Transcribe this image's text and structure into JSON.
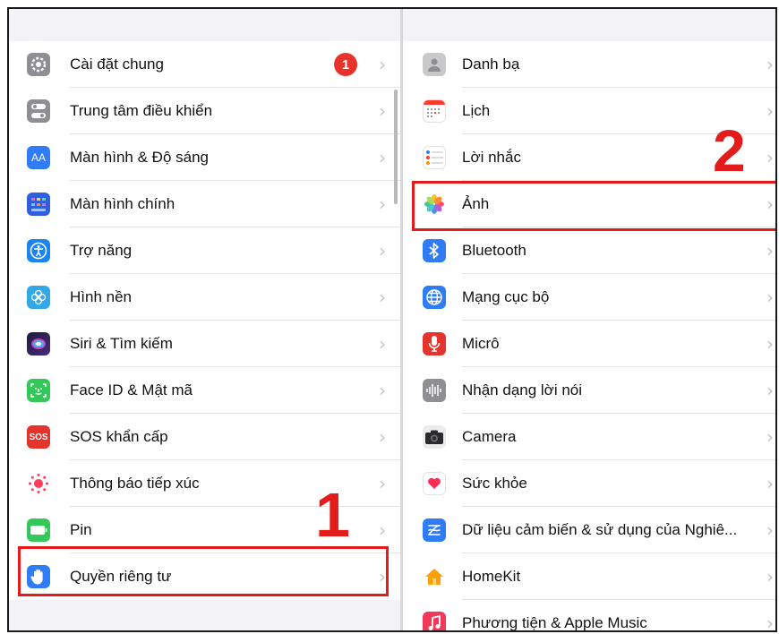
{
  "left_pane": {
    "items": [
      {
        "label": "Cài đặt chung",
        "icon": "gear-icon",
        "color": "#8e8e93",
        "badge": "1"
      },
      {
        "label": "Trung tâm điều khiển",
        "icon": "toggles-icon",
        "color": "#8e8e93"
      },
      {
        "label": "Màn hình & Độ sáng",
        "icon": "text-size-icon",
        "color": "#2f7cf6"
      },
      {
        "label": "Màn hình chính",
        "icon": "app-grid-icon",
        "color": "#2f5ee0"
      },
      {
        "label": "Trợ năng",
        "icon": "accessibility-icon",
        "color": "#1a84f2"
      },
      {
        "label": "Hình nền",
        "icon": "flower-icon",
        "color": "#32a8e6"
      },
      {
        "label": "Siri & Tìm kiếm",
        "icon": "siri-icon",
        "color": "#222244"
      },
      {
        "label": "Face ID & Mật mã",
        "icon": "face-id-icon",
        "color": "#34c759"
      },
      {
        "label": "SOS khẩn cấp",
        "icon": "sos-icon",
        "color": "#e5342c"
      },
      {
        "label": "Thông báo tiếp xúc",
        "icon": "exposure-icon",
        "color": "#ffffff"
      },
      {
        "label": "Pin",
        "icon": "battery-icon",
        "color": "#34c759"
      },
      {
        "label": "Quyền riêng tư",
        "icon": "hand-icon",
        "color": "#2f7cf6"
      }
    ]
  },
  "right_pane": {
    "items": [
      {
        "label": "Danh bạ",
        "icon": "contacts-icon",
        "color": "#c9c9cc"
      },
      {
        "label": "Lịch",
        "icon": "calendar-icon",
        "color": "#ffffff"
      },
      {
        "label": "Lời nhắc",
        "icon": "reminders-icon",
        "color": "#ffffff"
      },
      {
        "label": "Ảnh",
        "icon": "photos-icon",
        "color": "#ffffff"
      },
      {
        "label": "Bluetooth",
        "icon": "bluetooth-icon",
        "color": "#2f7cf6"
      },
      {
        "label": "Mạng cục bộ",
        "icon": "globe-icon",
        "color": "#2f7cf6"
      },
      {
        "label": "Micrô",
        "icon": "microphone-icon",
        "color": "#e5342c"
      },
      {
        "label": "Nhận dạng lời nói",
        "icon": "waveform-icon",
        "color": "#8e8e93"
      },
      {
        "label": "Camera",
        "icon": "camera-icon",
        "color": "#ffffff"
      },
      {
        "label": "Sức khỏe",
        "icon": "heart-icon",
        "color": "#ffffff"
      },
      {
        "label": "Dữ liệu cảm biến & sử dụng của Nghiê...",
        "icon": "sensor-icon",
        "color": "#2f7cf6"
      },
      {
        "label": "HomeKit",
        "icon": "home-icon",
        "color": "#ffffff"
      },
      {
        "label": "Phương tiện & Apple Music",
        "icon": "music-icon",
        "color": "#f2395a"
      }
    ]
  },
  "annotations": {
    "step_1": "1",
    "step_2": "2",
    "highlight_color": "#e31b1b"
  }
}
